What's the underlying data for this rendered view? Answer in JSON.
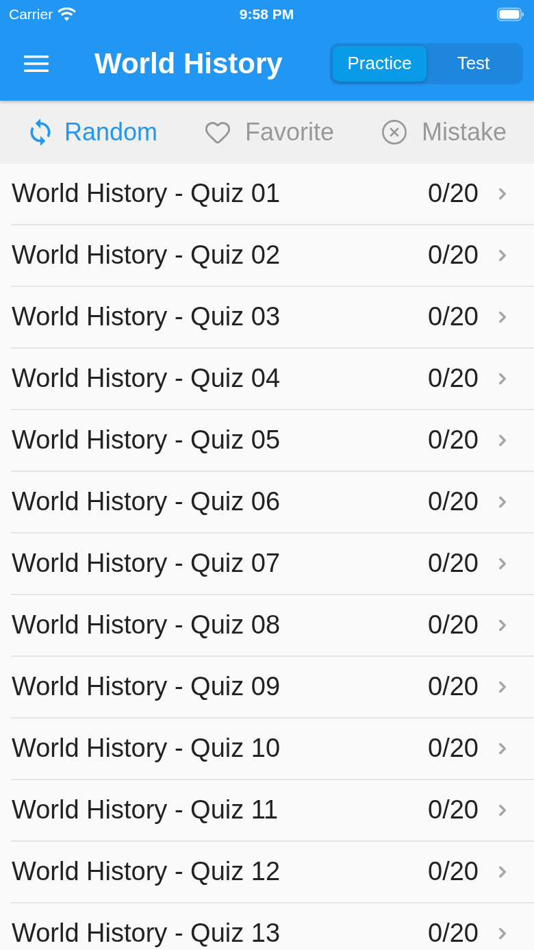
{
  "status_bar": {
    "carrier": "Carrier",
    "time": "9:58 PM"
  },
  "app_bar": {
    "title": "World History",
    "modes": [
      {
        "label": "Practice",
        "selected": true
      },
      {
        "label": "Test",
        "selected": false
      }
    ]
  },
  "filters": [
    {
      "kind": "random",
      "label": "Random",
      "selected": true
    },
    {
      "kind": "favorite",
      "label": "Favorite",
      "selected": false
    },
    {
      "kind": "mistake",
      "label": "Mistake",
      "selected": false
    }
  ],
  "quizzes": [
    {
      "title": "World History - Quiz 01",
      "score": "0/20"
    },
    {
      "title": "World History - Quiz 02",
      "score": "0/20"
    },
    {
      "title": "World History - Quiz 03",
      "score": "0/20"
    },
    {
      "title": "World History - Quiz 04",
      "score": "0/20"
    },
    {
      "title": "World History - Quiz 05",
      "score": "0/20"
    },
    {
      "title": "World History - Quiz 06",
      "score": "0/20"
    },
    {
      "title": "World History - Quiz 07",
      "score": "0/20"
    },
    {
      "title": "World History - Quiz 08",
      "score": "0/20"
    },
    {
      "title": "World History - Quiz 09",
      "score": "0/20"
    },
    {
      "title": "World History - Quiz 10",
      "score": "0/20"
    },
    {
      "title": "World History - Quiz 11",
      "score": "0/20"
    },
    {
      "title": "World History - Quiz 12",
      "score": "0/20"
    },
    {
      "title": "World History - Quiz 13",
      "score": "0/20"
    }
  ]
}
